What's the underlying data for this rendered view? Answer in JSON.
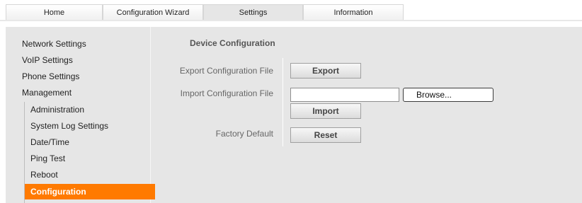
{
  "tabs": [
    {
      "label": "Home"
    },
    {
      "label": "Configuration Wizard"
    },
    {
      "label": "Settings"
    },
    {
      "label": "Information"
    }
  ],
  "sidebar": {
    "items": [
      {
        "label": "Network Settings"
      },
      {
        "label": "VoIP Settings"
      },
      {
        "label": "Phone Settings"
      },
      {
        "label": "Management"
      }
    ],
    "subitems": [
      {
        "label": "Administration"
      },
      {
        "label": "System Log Settings"
      },
      {
        "label": "Date/Time"
      },
      {
        "label": "Ping Test"
      },
      {
        "label": "Reboot"
      },
      {
        "label": "Configuration"
      }
    ]
  },
  "main": {
    "title": "Device Configuration",
    "export": {
      "label": "Export Configuration File",
      "button": "Export"
    },
    "import": {
      "label": "Import Configuration File",
      "file_value": "",
      "browse_button": "Browse...",
      "button": "Import"
    },
    "factory": {
      "label": "Factory Default",
      "button": "Reset"
    }
  },
  "colors": {
    "accent": "#ff7a00",
    "panel": "#e6e6e6"
  }
}
